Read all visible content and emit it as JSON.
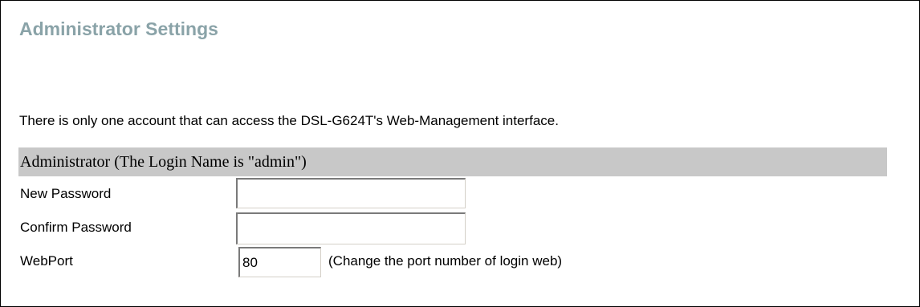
{
  "page": {
    "title": "Administrator Settings",
    "intro": "There is only one account that can access the DSL-G624T's Web-Management interface."
  },
  "admin_section": {
    "header": "Administrator (The Login Name is \"admin\")",
    "new_password": {
      "label": "New Password",
      "value": ""
    },
    "confirm_password": {
      "label": "Confirm Password",
      "value": ""
    },
    "web_port": {
      "label": "WebPort",
      "value": "80",
      "hint": "(Change the port number of login web)"
    }
  },
  "colors": {
    "title": "#8aa3a8",
    "section_header_bg": "#c8c8c8",
    "border": "#000000"
  }
}
